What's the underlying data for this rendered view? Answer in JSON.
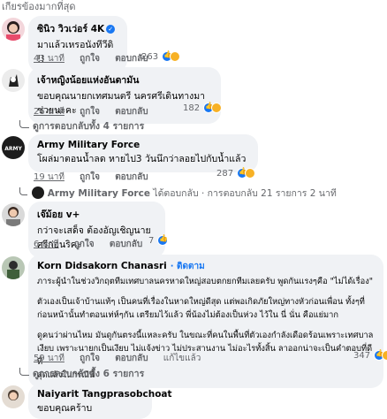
{
  "top_label": "เกียรข้องมากที่สุด",
  "comments": [
    {
      "author": "ซินิว วิวเว่อร์ 4K",
      "verified": true,
      "text": [
        "มาแล้วเหรอนังทีวีดิ !!"
      ],
      "time": "43 นาที",
      "like": "ถูกใจ",
      "reply": "ตอบกลับ",
      "reaction_count": "263"
    },
    {
      "author": "เจ้าหญิงน้อยแห่งอันดามัน",
      "verified": false,
      "text": [
        "ขอบคุณนายกเทศมนตรี นครศรีเดินทางมาช่วยนะคะ"
      ],
      "time": "26 นาที",
      "like": "ถูกใจ",
      "reply": "ตอบกลับ",
      "reaction_count": "182",
      "replies_link": "ดูการตอบกลับทั้ง 4 รายการ"
    },
    {
      "author": "Army Military Force",
      "verified": false,
      "text": [
        "โผล่มาตอนน้ำลด หายไป3 วันนึกว่าลอยไปกับน้ำแล้ว"
      ],
      "time": "19 นาที",
      "like": "ถูกใจ",
      "reply": "ตอบกลับ",
      "reaction_count": "287",
      "sub_reply": {
        "author": "Army Military Force",
        "action": "ได้ตอบกลับ",
        "summary": "· การตอบกลับ 21 รายการ",
        "time": "2 นาที"
      }
    },
    {
      "author": "เจ๊ม้อย v+",
      "verified": false,
      "text": [
        "กว่าจะเสด็จ ต้องอัญเชิญนายศรีก่อนริคะ"
      ],
      "time": "6 นาที",
      "like": "ถูกใจ",
      "reply": "ตอบกลับ",
      "reaction_count": "7"
    },
    {
      "author": "Korn Didsakorn Chanasri",
      "follow": "· ติดตาม",
      "verified": false,
      "text": [
        "ภาระผู้นำในช่วงวิกฤตทีมเทศบาลนครหาดใหญ่สอบตกยกทีมเลยครับ พูดกันแรงๆคือ \"ไม่ได้เรื่อง\"",
        "ตัวเองเป็นเจ้าบ้านแท้ๆ เป็นคนที่เรื่องในหาดใหญ่ดีสุด แต่พอเกิดภัยใหญ่ทางหัวก่อนเพื่อน ทั้งๆที่",
        "ก่อนหน้านั้นทำตอนเท่ห์ๆกัน เตรียมไว้แล้ว พี่น้องไม่ต้องเป็นห่วง ไว้ใน นี่ นั่น คือแย่มาก",
        "ดูคนว่าผ่านไหม มันดูกันตรงนี้แหละครับ ในขณะที่คนในพื้นที่ตัวเองกำลังเดือดร้อนเพราะเทศบาล",
        "เงียบ เพราะนายกเป็นเงียบ ไม่แจ้งข่าว ไม่ประสานงาน ไม่อะไรทั้งสิ้น ลาออกน่าจะเป็นคำตอบที่ดีที่",
        "สุดแล้วในกรณีนี้"
      ],
      "time": "59 นาที",
      "like": "ถูกใจ",
      "reply": "ตอบกลับ",
      "edited": "แก้ไขแล้ว",
      "reaction_count": "347",
      "replies_link": "ดูการตอบกลับทั้ง 6 รายการ"
    },
    {
      "author": "Naiyarit Tangprasobchoat",
      "verified": false,
      "text": [
        "ขอบคุณคร้าบ"
      ]
    }
  ],
  "colors": {
    "bubble": "#f0f2f5",
    "link_blue": "#1877f2",
    "meta_gray": "#65676b"
  }
}
